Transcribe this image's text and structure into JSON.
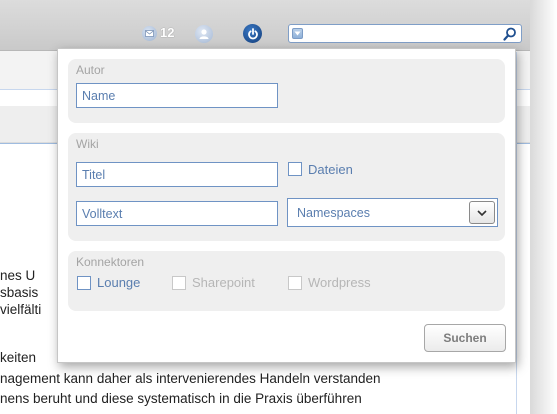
{
  "toolbar": {
    "message_count": "12",
    "search_value": "",
    "icons": [
      "mail-icon",
      "user-icon",
      "power-icon",
      "search-icon"
    ]
  },
  "background_text": {
    "lines": [
      "nes U",
      "sbasis",
      "vielfälti",
      "keiten",
      "nagement kann daher als intervenierendes Handeln verstanden",
      "nens beruht und diese systematisch in die Praxis überführen"
    ]
  },
  "search_popup": {
    "author_section": {
      "title": "Autor",
      "name_field": "Name"
    },
    "wiki_section": {
      "title": "Wiki",
      "title_field": "Titel",
      "files_label": "Dateien",
      "fulltext_field": "Volltext",
      "namespaces_selected": "Namespaces"
    },
    "connectors_section": {
      "title": "Konnektoren",
      "items": [
        {
          "label": "Lounge",
          "enabled": true
        },
        {
          "label": "Sharepoint",
          "enabled": false
        },
        {
          "label": "Wordpress",
          "enabled": false
        }
      ]
    },
    "submit_label": "Suchen"
  },
  "colors": {
    "accent": "#6f93c4",
    "field_text": "#5a7eaf",
    "section_bg": "#efefef",
    "muted_text": "#a4a4a4"
  }
}
